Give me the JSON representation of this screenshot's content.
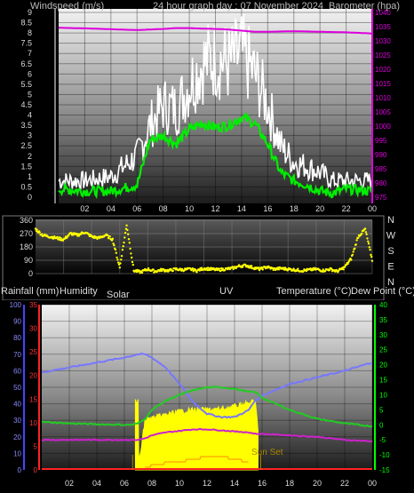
{
  "header": {
    "windspeed_label": "Windspeed (m/s)",
    "title": "24 hour graph day : 07 November 2024",
    "barometer_label": "Barometer (hpa)"
  },
  "x_ticks": [
    "02",
    "04",
    "06",
    "08",
    "10",
    "12",
    "14",
    "16",
    "18",
    "20",
    "22",
    "00"
  ],
  "panel1": {
    "wind_ticks": [
      "9",
      "8.5",
      "8",
      "7.5",
      "7",
      "6.5",
      "6",
      "5.5",
      "5",
      "4.5",
      "4",
      "3.5",
      "3",
      "2.5",
      "2",
      "1.5",
      "1",
      "0.5",
      "0"
    ],
    "baro_ticks": [
      "1040",
      "1035",
      "1030",
      "1025",
      "1020",
      "1015",
      "1010",
      "1005",
      "1000",
      "995",
      "990",
      "985",
      "980",
      "975"
    ]
  },
  "panel2": {
    "dir_ticks": [
      "360",
      "270",
      "180",
      "90",
      "0"
    ],
    "compass": [
      "N",
      "W",
      "S",
      "E",
      "N"
    ]
  },
  "panel3": {
    "labels": {
      "rainfall": "Rainfall (mm)",
      "humidity": "Humidity",
      "solar": "Solar",
      "uv": "UV",
      "temperature": "Temperature (°C)",
      "dewpoint": "Dew Point (°C)"
    },
    "humidity_ticks": [
      "100",
      "90",
      "80",
      "70",
      "60",
      "50",
      "40",
      "30",
      "20",
      "10",
      "0"
    ],
    "rain_ticks": [
      "35",
      "30",
      "25",
      "20",
      "15",
      "10",
      "5",
      "0"
    ],
    "temp_ticks": [
      "40",
      "35",
      "30",
      "25",
      "20",
      "15",
      "10",
      "5",
      "0",
      "-5",
      "-10",
      "-15"
    ],
    "sun_set_label": "Sun Set"
  },
  "colors": {
    "gust": "#ffffff",
    "wind": "#00ee00",
    "barometer": "#dd00dd",
    "direction": "#ffff00",
    "humidity": "#7777ff",
    "temperature": "#22cc22",
    "dewpoint": "#cc22cc",
    "solar": "#ffff00",
    "uv": "#ff8800",
    "rain_axis": "#ff2222",
    "humidity_axis": "#4444ff",
    "temp_axis": "#00ff00"
  },
  "chart_data": [
    {
      "type": "line",
      "title": "24 hour graph day : 07 November 2024",
      "x_hours": [
        0,
        2,
        4,
        6,
        7,
        8,
        9,
        10,
        11,
        12,
        13,
        14,
        15,
        16,
        17,
        18,
        19,
        20,
        21,
        22,
        24
      ],
      "xlim": [
        0,
        24
      ],
      "series": [
        {
          "name": "Windspeed (m/s)",
          "axis": "left",
          "ylim": [
            0,
            9
          ],
          "values": [
            0.4,
            0.3,
            0.3,
            0.6,
            2.8,
            3.0,
            2.6,
            3.3,
            3.6,
            3.4,
            3.5,
            3.9,
            3.6,
            2.6,
            1.2,
            0.8,
            0.6,
            0.3,
            0.2,
            0.4,
            0.3
          ]
        },
        {
          "name": "Gust",
          "axis": "left",
          "ylim": [
            0,
            9
          ],
          "values": [
            0.8,
            0.8,
            1.0,
            2.0,
            3.5,
            4.5,
            4.3,
            5.5,
            6.5,
            6.8,
            6.5,
            7.0,
            6.0,
            4.5,
            2.5,
            1.7,
            1.5,
            1.2,
            0.8,
            0.8,
            0.8
          ]
        },
        {
          "name": "Barometer (hpa)",
          "axis": "right",
          "ylim": [
            975,
            1040
          ],
          "values": [
            1034.6,
            1034.4,
            1034.1,
            1033.8,
            1034.0,
            1034.2,
            1034.5,
            1034.5,
            1034.3,
            1034.2,
            1034.0,
            1033.6,
            1033.2,
            1033.2,
            1033.3,
            1033.4,
            1033.3,
            1033.2,
            1033.1,
            1033.0,
            1032.6
          ]
        }
      ]
    },
    {
      "type": "scatter",
      "x_hours": [
        0,
        0.5,
        1,
        1.5,
        2,
        2.5,
        3,
        3.5,
        4,
        4.5,
        5,
        5.5,
        6,
        6.5,
        7,
        7.5,
        8,
        8.5,
        9,
        9.5,
        10,
        10.5,
        11,
        11.5,
        12,
        12.5,
        13,
        13.5,
        14,
        14.5,
        15,
        15.5,
        16,
        16.5,
        17,
        17.5,
        18,
        18.5,
        19,
        19.5,
        20,
        20.5,
        21,
        21.5,
        22,
        22.5,
        23,
        23.5,
        24
      ],
      "xlim": [
        0,
        24
      ],
      "ylim": [
        0,
        360
      ],
      "series": [
        {
          "name": "Wind direction",
          "values": [
            300,
            260,
            250,
            240,
            230,
            270,
            260,
            280,
            250,
            240,
            260,
            230,
            40,
            330,
            20,
            10,
            30,
            15,
            25,
            20,
            30,
            25,
            30,
            20,
            35,
            30,
            25,
            30,
            35,
            50,
            55,
            40,
            30,
            45,
            30,
            35,
            30,
            25,
            20,
            25,
            30,
            20,
            30,
            15,
            40,
            100,
            250,
            300,
            90
          ]
        }
      ]
    },
    {
      "type": "area",
      "x_hours": [
        0,
        2,
        4,
        6,
        6.5,
        7,
        7.5,
        8,
        9,
        10,
        11,
        12,
        13,
        14,
        15,
        15.5,
        16,
        18,
        20,
        22,
        24
      ],
      "xlim": [
        0,
        24
      ],
      "series": [
        {
          "name": "Humidity",
          "axis": "left",
          "ylim": [
            0,
            100
          ],
          "values": [
            59,
            62,
            65,
            68,
            69,
            70,
            70,
            68,
            62,
            52,
            41,
            34,
            32,
            32,
            36,
            42,
            45,
            52,
            56,
            60,
            65
          ]
        },
        {
          "name": "Rainfall (mm)",
          "axis": "left",
          "ylim": [
            0,
            35
          ],
          "values": [
            0,
            0,
            0,
            0,
            0,
            0,
            0,
            0,
            0,
            0,
            0,
            0,
            0,
            0,
            0,
            0,
            0,
            0,
            0,
            0,
            0
          ]
        },
        {
          "name": "Temperature (°C)",
          "axis": "right",
          "ylim": [
            -15,
            40
          ],
          "values": [
            1,
            0.5,
            0.2,
            0,
            0,
            0.5,
            2,
            5,
            8,
            10,
            11.5,
            12.5,
            12.5,
            12,
            11,
            11,
            9,
            5,
            2,
            0.5,
            -0.5
          ]
        },
        {
          "name": "Dew Point (°C)",
          "axis": "right",
          "ylim": [
            -15,
            40
          ],
          "values": [
            -5,
            -5,
            -5,
            -5,
            -5,
            -5,
            -4.5,
            -3.5,
            -2.5,
            -2,
            -1.5,
            -1.5,
            -1.8,
            -2.2,
            -2.5,
            -3,
            -3,
            -3.5,
            -4,
            -5,
            -5.5
          ]
        },
        {
          "name": "Solar",
          "axis": "right_solar",
          "values": [
            0,
            0,
            0,
            0,
            0,
            0,
            0.6,
            0.62,
            0.66,
            0.7,
            0.72,
            0.72,
            0.73,
            0.76,
            0.8,
            0.82,
            0,
            0,
            0,
            0,
            0
          ]
        },
        {
          "name": "UV",
          "axis": "uv",
          "values": [
            0,
            0,
            0,
            0,
            0,
            0,
            0,
            0.3,
            0.8,
            1,
            1.5,
            2,
            2,
            1.5,
            1,
            0,
            0,
            0,
            0,
            0,
            0
          ]
        }
      ]
    }
  ]
}
